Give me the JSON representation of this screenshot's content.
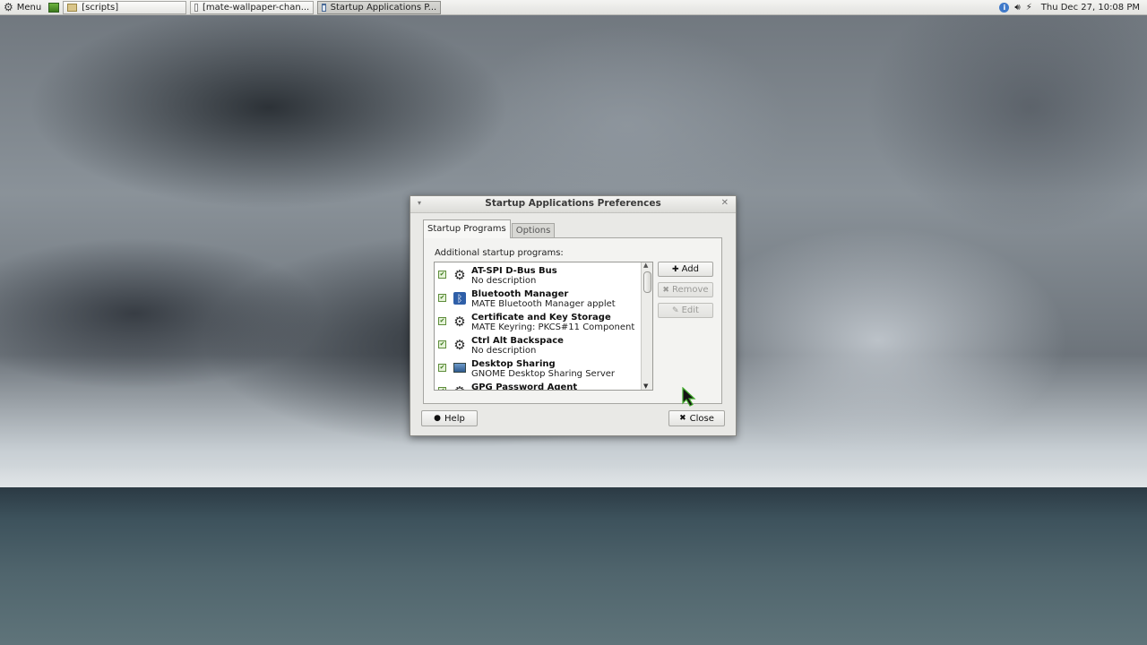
{
  "panel": {
    "menu_label": "Menu",
    "tasks": [
      {
        "label": "[scripts]",
        "icon": "folder-icon"
      },
      {
        "label": "[mate-wallpaper-chan...",
        "icon": "document-icon"
      },
      {
        "label": "Startup Applications P...",
        "icon": "window-icon"
      }
    ],
    "clock": "Thu Dec 27, 10:08 PM"
  },
  "dialog": {
    "title": "Startup Applications Preferences",
    "tabs": [
      "Startup Programs",
      "Options"
    ],
    "section_label": "Additional startup programs:",
    "programs": [
      {
        "name": "AT-SPI D-Bus Bus",
        "description": "No description",
        "enabled": true,
        "icon": "gear-icon"
      },
      {
        "name": "Bluetooth Manager",
        "description": "MATE Bluetooth Manager applet",
        "enabled": true,
        "icon": "bluetooth-icon"
      },
      {
        "name": "Certificate and Key Storage",
        "description": "MATE Keyring: PKCS#11 Component",
        "enabled": true,
        "icon": "gear-icon"
      },
      {
        "name": "Ctrl Alt Backspace",
        "description": "No description",
        "enabled": true,
        "icon": "gear-icon"
      },
      {
        "name": "Desktop Sharing",
        "description": "GNOME Desktop Sharing Server",
        "enabled": true,
        "icon": "screen-icon"
      },
      {
        "name": "GPG Password Agent",
        "description": "",
        "enabled": true,
        "icon": "gear-icon"
      }
    ],
    "buttons": {
      "add": "Add",
      "remove": "Remove",
      "edit": "Edit",
      "help": "Help",
      "close": "Close"
    }
  }
}
